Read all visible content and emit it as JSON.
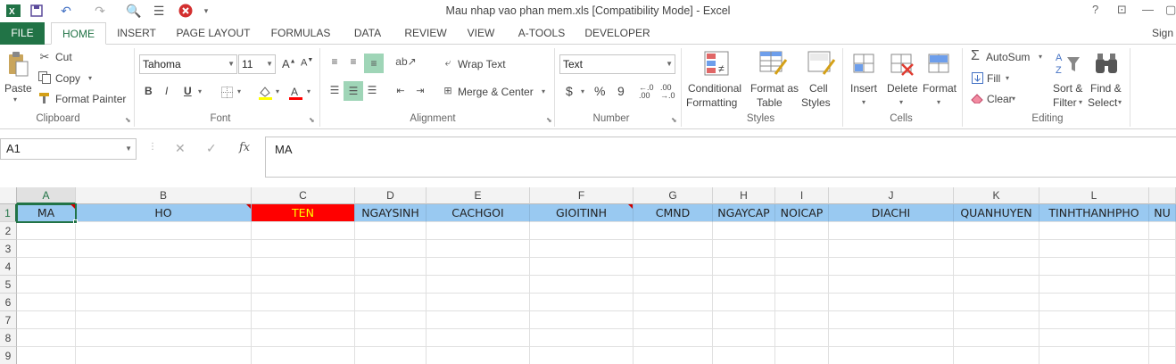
{
  "app": {
    "title": "Mau nhap vao phan mem.xls  [Compatibility Mode] - Excel",
    "signin": "Sign"
  },
  "tabs": [
    "FILE",
    "HOME",
    "INSERT",
    "PAGE LAYOUT",
    "FORMULAS",
    "DATA",
    "REVIEW",
    "VIEW",
    "A-TOOLS",
    "DEVELOPER"
  ],
  "ribbon": {
    "clipboard": {
      "paste": "Paste",
      "cut": "Cut",
      "copy": "Copy",
      "format_painter": "Format Painter",
      "label": "Clipboard"
    },
    "font": {
      "name": "Tahoma",
      "size": "11",
      "bold": "B",
      "italic": "I",
      "underline": "U",
      "label": "Font"
    },
    "alignment": {
      "wrap": "Wrap Text",
      "merge": "Merge & Center",
      "label": "Alignment"
    },
    "number": {
      "format": "Text",
      "currency": "$",
      "percent": "%",
      "comma": "9",
      "label": "Number"
    },
    "styles": {
      "conditional_1": "Conditional",
      "conditional_2": "Formatting",
      "format_table_1": "Format as",
      "format_table_2": "Table",
      "cell_styles_1": "Cell",
      "cell_styles_2": "Styles",
      "label": "Styles"
    },
    "cells": {
      "insert": "Insert",
      "delete": "Delete",
      "format": "Format",
      "label": "Cells"
    },
    "editing": {
      "autosum": "AutoSum",
      "fill": "Fill",
      "clear": "Clear",
      "sort_1": "Sort &",
      "sort_2": "Filter",
      "find_1": "Find &",
      "find_2": "Select",
      "label": "Editing"
    }
  },
  "formula": {
    "namebox": "A1",
    "content": "MA",
    "fx": "fx"
  },
  "columns": [
    "A",
    "B",
    "C",
    "D",
    "E",
    "F",
    "G",
    "H",
    "I",
    "J",
    "K",
    "L"
  ],
  "rows": [
    "1",
    "2",
    "3",
    "4",
    "5",
    "6",
    "7",
    "8",
    "9"
  ],
  "header_row": [
    "MA",
    "HO",
    "TEN",
    "NGAYSINH",
    "CACHGOI",
    "GIOITINH",
    "CMND",
    "NGAYCAP",
    "NOICAP",
    "DIACHI",
    "QUANHUYEN",
    "TINHTHANHPHO",
    "NU"
  ],
  "colors": {
    "excel_green": "#217346",
    "header_fill": "#99c9f1",
    "ten_fill": "#ff0000",
    "ten_text": "#ffff00"
  },
  "icons": [
    "excel-logo-icon",
    "save-icon",
    "undo-icon",
    "redo-icon",
    "print-preview-icon",
    "form-icon",
    "stop-icon"
  ]
}
